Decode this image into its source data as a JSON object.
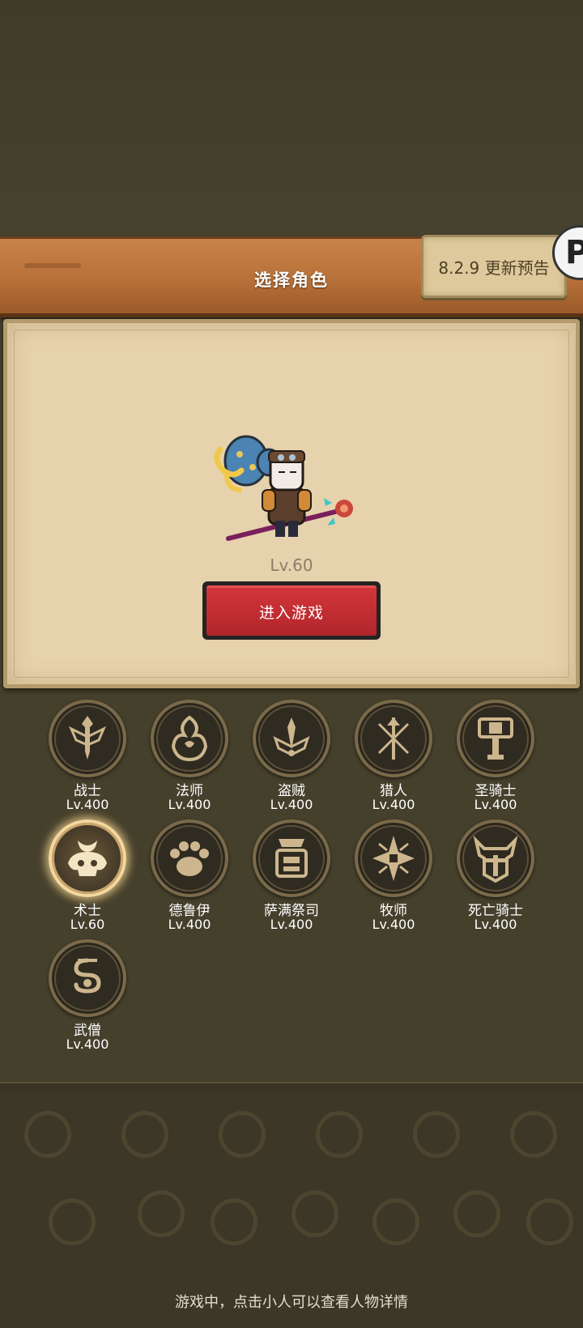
{
  "header": {
    "title": "选择角色",
    "update_notice": "8.2.9 更新预告",
    "fab_glyph": "P"
  },
  "hero": {
    "level": "Lv.60",
    "enter_label": "进入游戏"
  },
  "classes": [
    {
      "name": "战士",
      "level": "Lv.400",
      "icon": "warrior-sword-icon"
    },
    {
      "name": "法师",
      "level": "Lv.400",
      "icon": "mage-flame-icon"
    },
    {
      "name": "盗贼",
      "level": "Lv.400",
      "icon": "rogue-daggers-icon"
    },
    {
      "name": "猎人",
      "level": "Lv.400",
      "icon": "hunter-arrows-icon"
    },
    {
      "name": "圣骑士",
      "level": "Lv.400",
      "icon": "paladin-hammer-icon"
    },
    {
      "name": "术士",
      "level": "Lv.60",
      "icon": "warlock-skull-icon",
      "selected": true
    },
    {
      "name": "德鲁伊",
      "level": "Lv.400",
      "icon": "druid-paw-icon"
    },
    {
      "name": "萨满祭司",
      "level": "Lv.400",
      "icon": "shaman-totem-icon"
    },
    {
      "name": "牧师",
      "level": "Lv.400",
      "icon": "priest-star-icon"
    },
    {
      "name": "死亡骑士",
      "level": "Lv.400",
      "icon": "deathknight-helm-icon"
    },
    {
      "name": "武僧",
      "level": "Lv.400",
      "icon": "monk-swirl-icon"
    }
  ],
  "footer": {
    "hint": "游戏中，点击小人可以查看人物详情"
  },
  "colors": {
    "background": "#45402c",
    "plank": "#b87138",
    "parchment": "#e6d2ad",
    "enter_button": "#c22d32",
    "badge_symbol": "#cdb68d",
    "selected_glow": "#f3d7a0"
  }
}
